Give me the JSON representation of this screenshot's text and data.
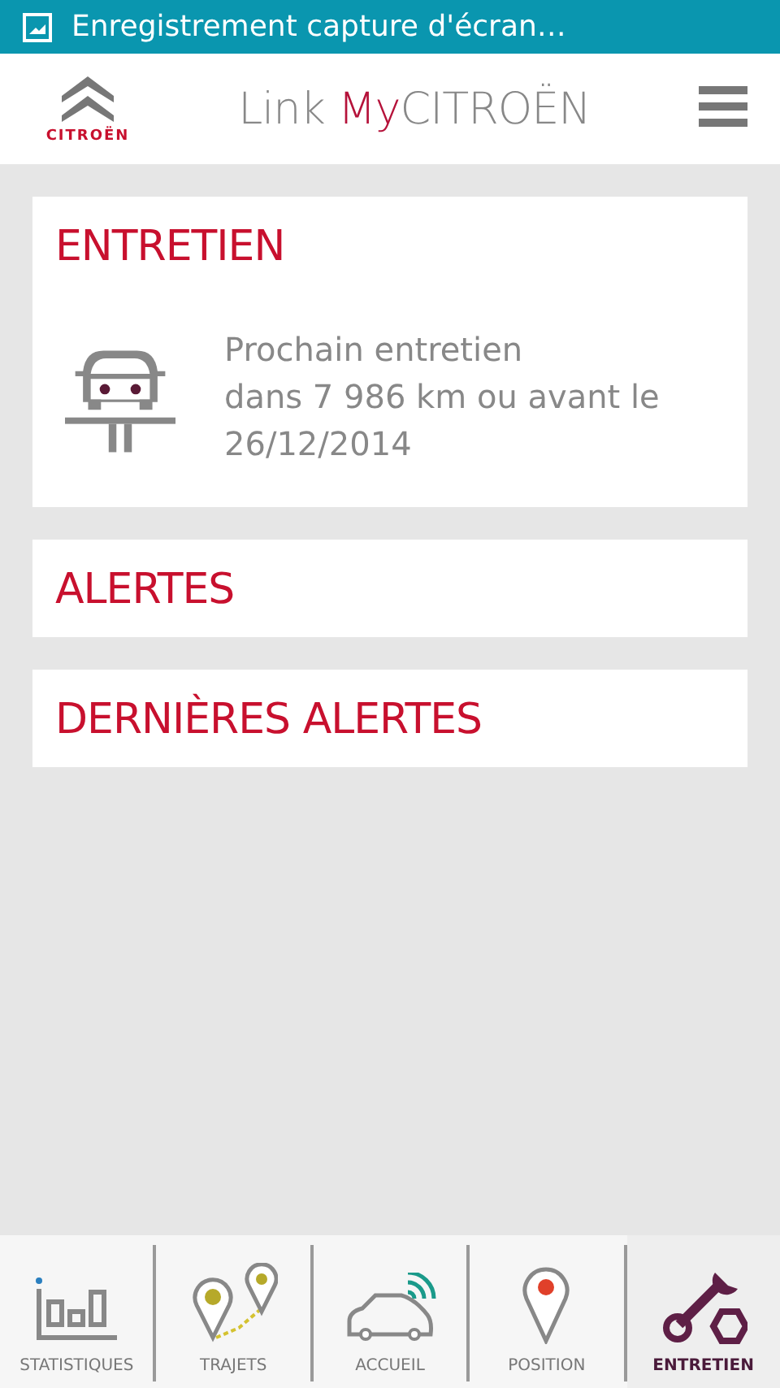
{
  "status_bar": {
    "notification": "Enregistrement capture d'écran…"
  },
  "header": {
    "logo_text": "CITROËN",
    "title": {
      "prefix": "Link ",
      "highlight": "My",
      "suffix": "CITROËN"
    }
  },
  "sections": [
    {
      "title": "ENTRETIEN",
      "kind": "maintenance",
      "line1": "Prochain entretien",
      "line2": "dans 7 986 km ou avant le 26/12/2014"
    },
    {
      "title": "ALERTES",
      "kind": "plain"
    },
    {
      "title": "DERNIÈRES ALERTES",
      "kind": "plain"
    }
  ],
  "nav": [
    {
      "label": "STATISTIQUES",
      "kind": "stats",
      "selected": false
    },
    {
      "label": "TRAJETS",
      "kind": "trips",
      "selected": false
    },
    {
      "label": "ACCUEIL",
      "kind": "home",
      "selected": false
    },
    {
      "label": "POSITION",
      "kind": "position",
      "selected": false
    },
    {
      "label": "ENTRETIEN",
      "kind": "maintenance",
      "selected": true
    }
  ]
}
